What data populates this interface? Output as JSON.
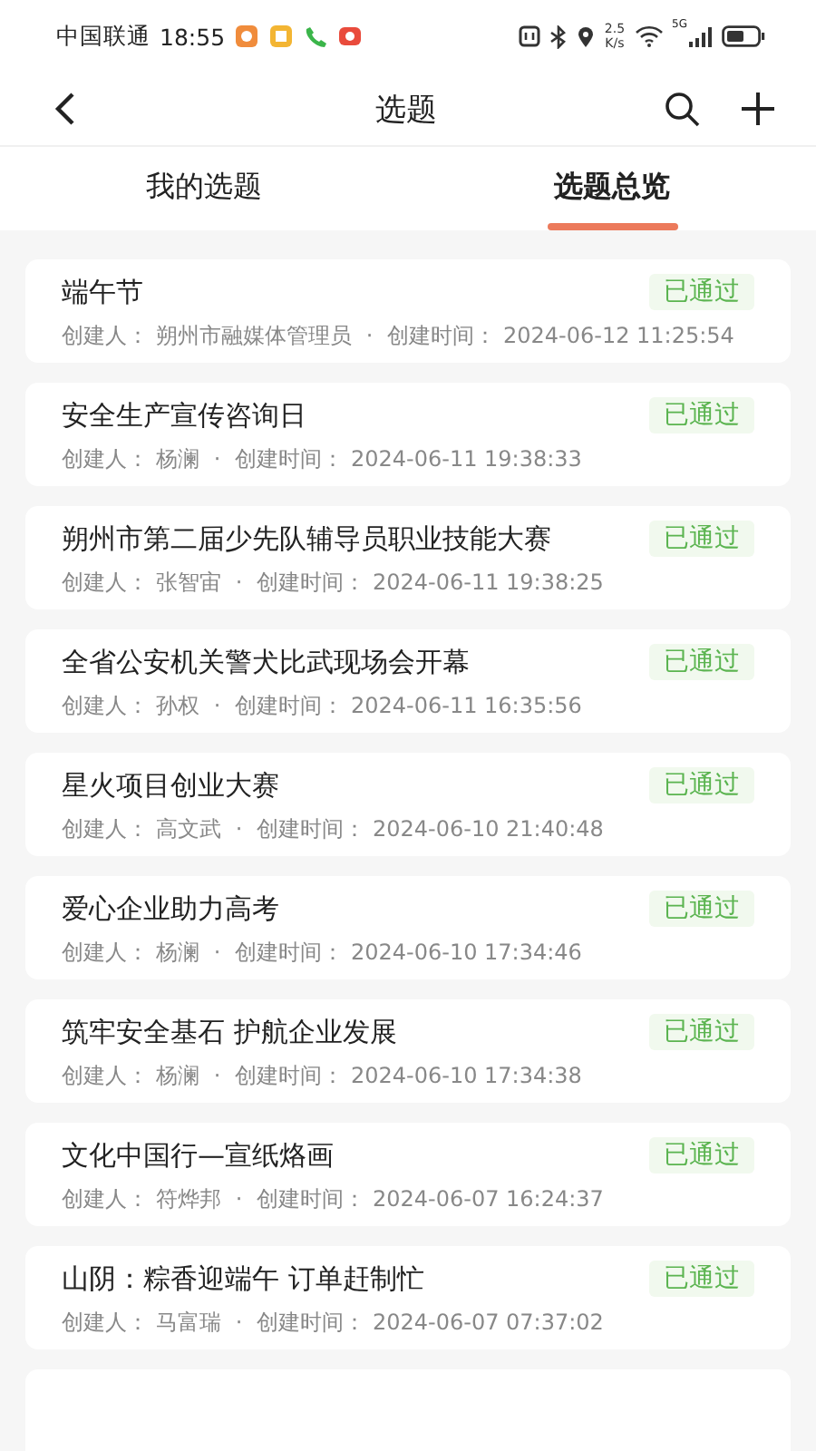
{
  "status_bar": {
    "carrier": "中国联通",
    "time": "18:55",
    "speed_value": "2.5",
    "speed_unit": "K/s",
    "network": "5G"
  },
  "header": {
    "title": "选题"
  },
  "tabs": [
    {
      "label": "我的选题",
      "selected": false
    },
    {
      "label": "选题总览",
      "selected": true
    }
  ],
  "topics": [
    {
      "title": "端午节",
      "status": "已通过",
      "creator_label": "创建人：",
      "creator": "朔州市融媒体管理员",
      "separator": "·",
      "time_label": "创建时间：",
      "time": "2024-06-12 11:25:54"
    },
    {
      "title": "安全生产宣传咨询日",
      "status": "已通过",
      "creator_label": "创建人：",
      "creator": "杨澜",
      "separator": "·",
      "time_label": "创建时间：",
      "time": "2024-06-11 19:38:33"
    },
    {
      "title": "朔州市第二届少先队辅导员职业技能大赛",
      "status": "已通过",
      "creator_label": "创建人：",
      "creator": "张智宙",
      "separator": "·",
      "time_label": "创建时间：",
      "time": "2024-06-11 19:38:25"
    },
    {
      "title": "全省公安机关警犬比武现场会开幕",
      "status": "已通过",
      "creator_label": "创建人：",
      "creator": "孙权",
      "separator": "·",
      "time_label": "创建时间：",
      "time": "2024-06-11 16:35:56"
    },
    {
      "title": "星火项目创业大赛",
      "status": "已通过",
      "creator_label": "创建人：",
      "creator": "高文武",
      "separator": "·",
      "time_label": "创建时间：",
      "time": "2024-06-10 21:40:48"
    },
    {
      "title": "爱心企业助力高考",
      "status": "已通过",
      "creator_label": "创建人：",
      "creator": "杨澜",
      "separator": "·",
      "time_label": "创建时间：",
      "time": "2024-06-10 17:34:46"
    },
    {
      "title": "筑牢安全基石 护航企业发展",
      "status": "已通过",
      "creator_label": "创建人：",
      "creator": "杨澜",
      "separator": "·",
      "time_label": "创建时间：",
      "time": "2024-06-10 17:34:38"
    },
    {
      "title": "文化中国行—宣纸烙画",
      "status": "已通过",
      "creator_label": "创建人：",
      "creator": "符烨邦",
      "separator": "·",
      "time_label": "创建时间：",
      "time": "2024-06-07 16:24:37"
    },
    {
      "title": "山阴：粽香迎端午 订单赶制忙",
      "status": "已通过",
      "creator_label": "创建人：",
      "creator": "马富瑞",
      "separator": "·",
      "time_label": "创建时间：",
      "time": "2024-06-07 07:37:02"
    }
  ]
}
